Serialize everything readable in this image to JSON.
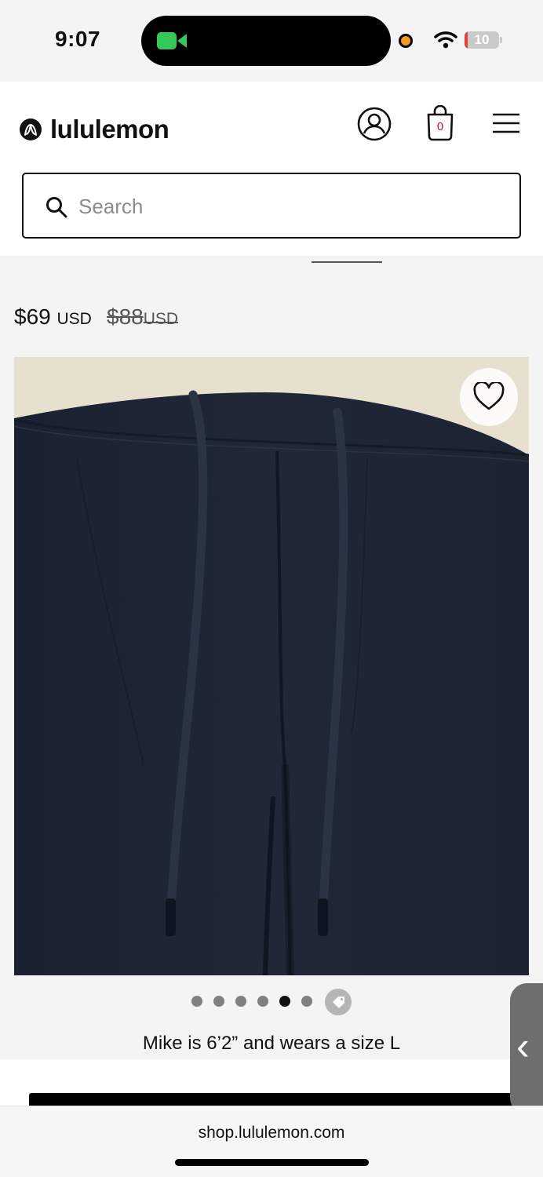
{
  "status_bar": {
    "time": "9:07",
    "battery_level": "10",
    "battery_percent": 10,
    "icons": [
      "facetime-camera-icon",
      "recording-indicator-icon",
      "wifi-icon",
      "battery-icon"
    ]
  },
  "header": {
    "brand": "lululemon",
    "cart_count": "0",
    "icons": [
      "lululemon-logo-icon",
      "account-icon",
      "bag-icon",
      "menu-icon"
    ]
  },
  "search": {
    "placeholder": "Search",
    "value": ""
  },
  "product": {
    "price": "$69",
    "price_currency": "USD",
    "original_price": "$88",
    "original_currency": "USD"
  },
  "carousel": {
    "total_images": 6,
    "active_index": 4
  },
  "model_info": "Mike is 6’2” and wears a size L",
  "browser": {
    "url": "shop.lululemon.com"
  },
  "colors": {
    "accent_red": "#c8102e",
    "product_navy": "#1b2230",
    "background": "#f4f4f4"
  }
}
